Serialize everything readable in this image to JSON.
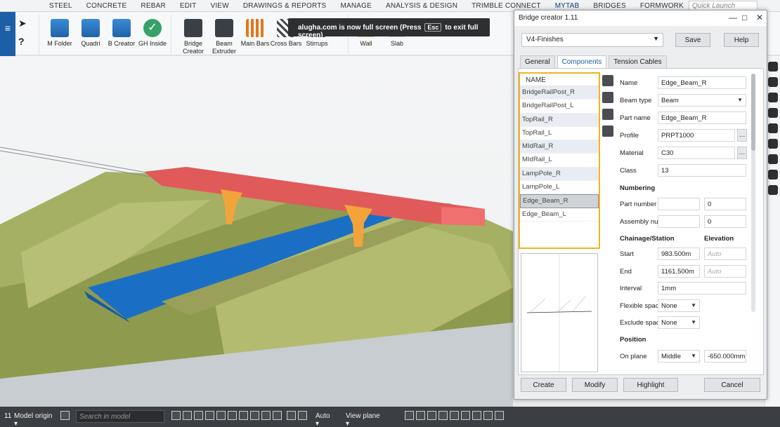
{
  "top_menu": [
    "STEEL",
    "CONCRETE",
    "REBAR",
    "EDIT",
    "VIEW",
    "DRAWINGS & REPORTS",
    "MANAGE",
    "ANALYSIS & DESIGN",
    "TRIMBLE CONNECT",
    "MYTAB",
    "BRIDGES",
    "FORMWORK"
  ],
  "quick_launch_placeholder": "Quick Launch",
  "ribbon": {
    "group1": [
      {
        "label": "M Folder",
        "icon": "folder-cube-icon"
      },
      {
        "label": "Quadri",
        "icon": "gear-cube-icon"
      },
      {
        "label": "B Creator",
        "icon": "bridge-icon"
      },
      {
        "label": "GH Inside",
        "icon": "check-circle-icon"
      }
    ],
    "group2": [
      {
        "label": "Bridge\nCreator",
        "icon": "bridge-icon"
      },
      {
        "label": "Beam\nExtruder",
        "icon": "beam-icon"
      },
      {
        "label": "Main Bars",
        "icon": "rebar-icon"
      },
      {
        "label": "Cross Bars",
        "icon": "crossbar-icon"
      },
      {
        "label": "Stirrups",
        "icon": "stirrup-icon"
      }
    ],
    "group3": [
      {
        "label": "Wall",
        "icon": "wall-icon"
      },
      {
        "label": "Slab",
        "icon": "slab-icon"
      }
    ]
  },
  "toast": {
    "before": "alugha.com is now full screen (Press",
    "key": "Esc",
    "after": "to exit full screen)"
  },
  "status_bar": {
    "origin_label": "Model origin",
    "search_placeholder": "Search in model",
    "snap_mode": "Auto",
    "view_plane": "View plane",
    "corner_text": "11"
  },
  "dialog": {
    "title": "Bridge creator 1.11",
    "preset": "V4-Finishes",
    "save": "Save",
    "help": "Help",
    "tabs": [
      "General",
      "Components",
      "Tension Cables"
    ],
    "active_tab": "Components",
    "list_header": "NAME",
    "components": [
      "BridgeRailPost_R",
      "BridgeRailPost_L",
      "TopRail_R",
      "TopRail_L",
      "MIdRail_R",
      "MIdRail_L",
      "LampPole_R",
      "LampPole_L",
      "Edge_Beam_R",
      "Edge_Beam_L"
    ],
    "selected_component": "Edge_Beam_R",
    "props": {
      "name_label": "Name",
      "name": "Edge_Beam_R",
      "beam_type_label": "Beam type",
      "beam_type": "Beam",
      "part_name_label": "Part name",
      "part_name": "Edge_Beam_R",
      "profile_label": "Profile",
      "profile": "PRPT1000",
      "material_label": "Material",
      "material": "C30",
      "class_label": "Class",
      "class": "13",
      "numbering": "Numbering",
      "part_number_label": "Part number",
      "part_number_prefix": "",
      "part_number": "0",
      "assembly_label": "Assembly nu",
      "assembly_prefix": "",
      "assembly_number": "0",
      "chainage": "Chainage/Station",
      "elevation": "Elevation",
      "start_label": "Start",
      "start": "983.500m",
      "start_elev": "Auto",
      "end_label": "End",
      "end": "1161.500m",
      "end_elev": "Auto",
      "interval_label": "Interval",
      "interval": "1mm",
      "flex_label": "Flexible spac",
      "flex": "None",
      "exclude_label": "Exclude spac",
      "exclude": "None",
      "position": "Position",
      "on_plane_label": "On plane",
      "on_plane": "Middle",
      "on_plane_offset": "-650.000mm"
    },
    "buttons": {
      "create": "Create",
      "modify": "Modify",
      "highlight": "Highlight",
      "cancel": "Cancel"
    }
  },
  "colors": {
    "accent": "#1c5fa7",
    "highlight": "#f0b323",
    "deck": "#e05a5a",
    "pier": "#f2a43a",
    "water": "#1a6fc4",
    "terrain": "#a9b068"
  }
}
